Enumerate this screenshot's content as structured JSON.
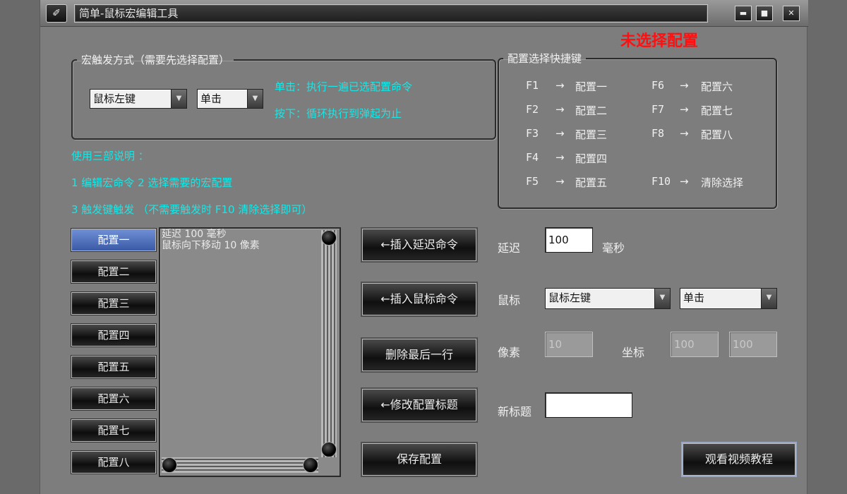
{
  "window": {
    "title": "简单-鼠标宏编辑工具",
    "app_icon_glyph": "✐",
    "controls": {
      "minimize": "▬",
      "maximize": "■",
      "close": "✕"
    }
  },
  "status": {
    "text": "未选择配置",
    "color": "#ff1010"
  },
  "trigger_group": {
    "legend": "宏触发方式（需要先选择配置）",
    "button_combo": "鼠标左键",
    "action_combo": "单击",
    "note_click": "单击：执行一遍已选配置命令",
    "note_press": "按下：循环执行到弹起为止"
  },
  "instructions": {
    "header": "使用三部说明 ：",
    "line1": "1 编辑宏命令  2 选择需要的宏配置",
    "line2": "3 触发键触发 （不需要触发时 F10 清除选择即可）"
  },
  "shortcut_group": {
    "legend": "配置选择快捷键",
    "left": [
      {
        "key": "F1",
        "arrow": "→",
        "target": "配置一"
      },
      {
        "key": "F2",
        "arrow": "→",
        "target": "配置二"
      },
      {
        "key": "F3",
        "arrow": "→",
        "target": "配置三"
      },
      {
        "key": "F4",
        "arrow": "→",
        "target": "配置四"
      },
      {
        "key": "F5",
        "arrow": "→",
        "target": "配置五"
      }
    ],
    "right": [
      {
        "key": "F6",
        "arrow": "→",
        "target": "配置六"
      },
      {
        "key": "F7",
        "arrow": "→",
        "target": "配置七"
      },
      {
        "key": "F8",
        "arrow": "→",
        "target": "配置八"
      },
      {
        "key": "F10",
        "arrow": "→",
        "target": "清除选择"
      }
    ]
  },
  "configs": [
    "配置一",
    "配置二",
    "配置三",
    "配置四",
    "配置五",
    "配置六",
    "配置七",
    "配置八"
  ],
  "active_config": 0,
  "command_list": [
    "延迟 100 毫秒",
    "鼠标向下移动 10 像素"
  ],
  "buttons": {
    "insert_delay": "←插入延迟命令",
    "insert_mouse": "←插入鼠标命令",
    "delete_last": "删除最后一行",
    "rename_config": "←修改配置标题",
    "save_config": "保存配置",
    "watch_video": "观看视频教程"
  },
  "delay": {
    "label": "延迟",
    "value": "100",
    "unit": "毫秒"
  },
  "mouse": {
    "label": "鼠标",
    "button_combo": "鼠标左键",
    "action_combo": "单击"
  },
  "pixel": {
    "label": "像素",
    "value": "10"
  },
  "coords": {
    "label": "坐标",
    "x": "100",
    "y": "100"
  },
  "new_title": {
    "label": "新标题",
    "value": ""
  },
  "colors": {
    "accent_cyan": "#19e6e6",
    "active_blue": "#3b5aa6",
    "status_red": "#ff1010"
  }
}
